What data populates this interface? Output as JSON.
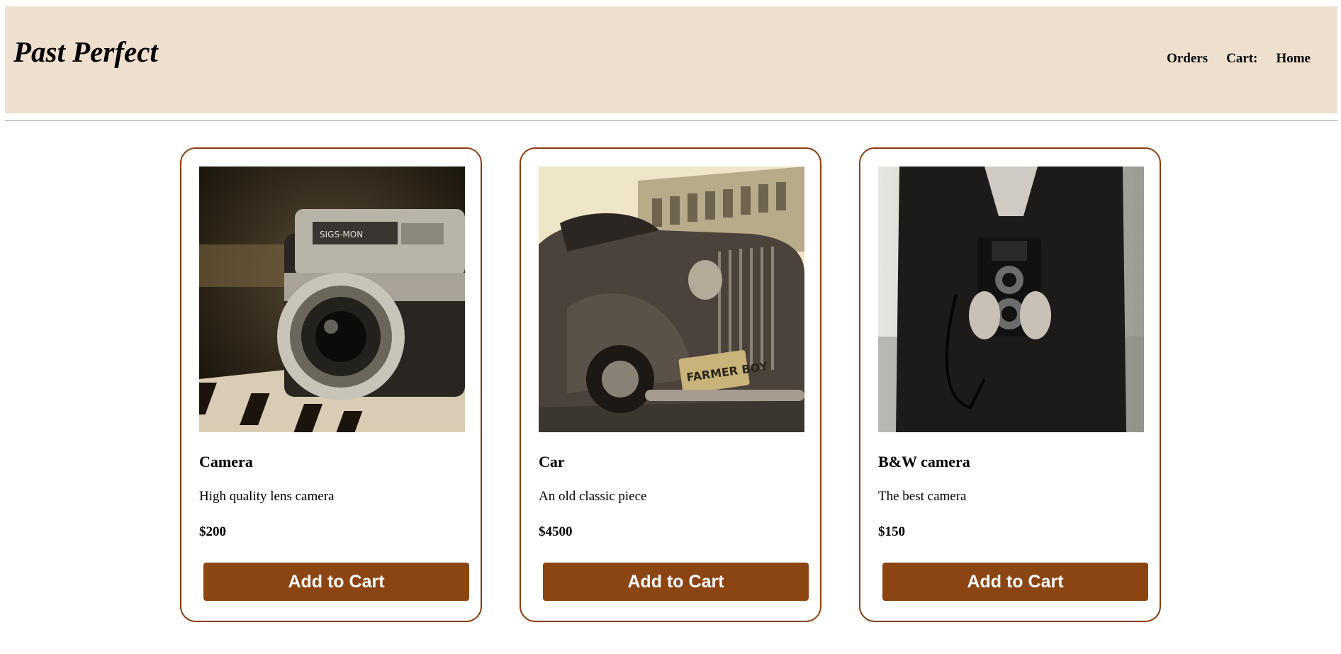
{
  "header": {
    "brand": "Past Perfect",
    "nav": {
      "orders": "Orders",
      "cart": "Cart:",
      "home": "Home"
    }
  },
  "products": [
    {
      "name": "Camera",
      "description": "High quality lens camera",
      "price": "$200",
      "button": "Add to Cart",
      "image": "vintage-camera-photo",
      "plate_text": ""
    },
    {
      "name": "Car",
      "description": "An old classic piece",
      "price": "$4500",
      "button": "Add to Cart",
      "image": "classic-car-photo",
      "plate_text": "FARMER BOY"
    },
    {
      "name": "B&W camera",
      "description": "The best camera",
      "price": "$150",
      "button": "Add to Cart",
      "image": "person-holding-twin-lens-camera-photo",
      "plate_text": ""
    }
  ],
  "colors": {
    "header_bg": "#eedfcf",
    "accent": "#8b4513",
    "card_border": "#8a3c0f"
  }
}
